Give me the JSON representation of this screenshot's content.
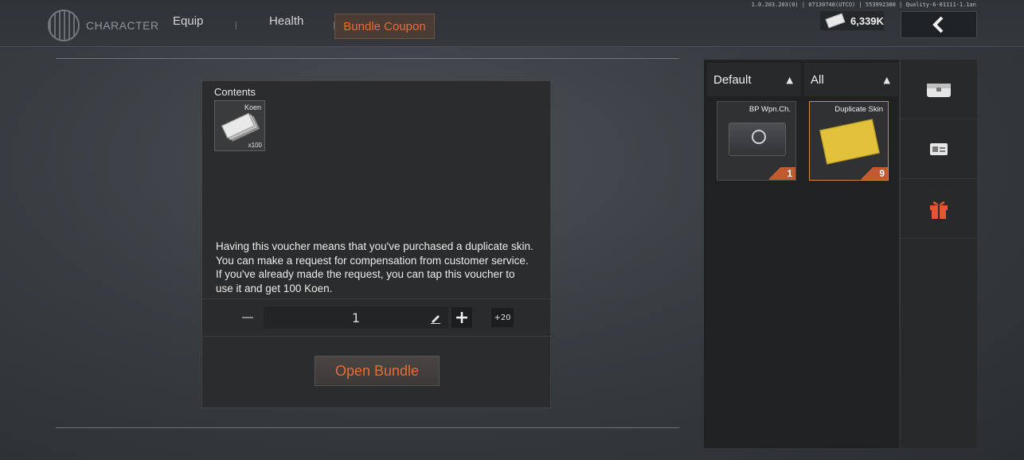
{
  "header": {
    "brand_label": "CHARACTER",
    "tabs": [
      "Equip",
      "Health"
    ],
    "active_tab": "Bundle Coupon",
    "version_text": "1.0.203.203(0) | 07130748(UTCO) | 553992380 | Quality-6-01111-1.1an",
    "currency": {
      "icon": "koen-bill-icon",
      "value": "6,339K"
    },
    "back_icon": "chevron-left-icon"
  },
  "bundle": {
    "contents_label": "Contents",
    "item": {
      "name": "Koen",
      "quantity": "x100",
      "icon": "koen-stack-icon"
    },
    "description": "Having this voucher means that you've purchased a duplicate skin. You can make a request for compensation from customer service. If you've already made the request, you can tap this voucher to use it and get 100 Koen.",
    "quantity_value": "1",
    "plus20_label": "+20",
    "open_button_label": "Open Bundle"
  },
  "inventory": {
    "filter_sort": "Default",
    "filter_category": "All",
    "cards": [
      {
        "name": "BP Wpn.Ch.",
        "count": "1",
        "selected": false
      },
      {
        "name": "Duplicate Skin",
        "count": "9",
        "selected": true
      }
    ]
  },
  "side_tabs": [
    "chest-icon",
    "id-card-icon",
    "gift-icon"
  ],
  "colors": {
    "accent": "#ec6a2f",
    "selected_border": "#d58a3b",
    "gift": "#e4572e"
  }
}
